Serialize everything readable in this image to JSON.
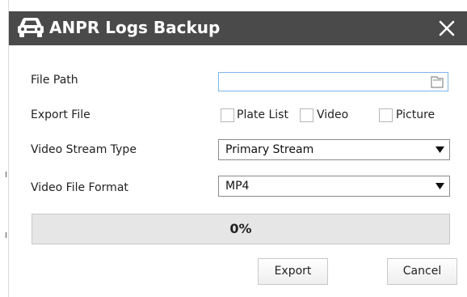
{
  "dialog": {
    "title": "ANPR Logs Backup",
    "title_icon": "car-icon",
    "close_icon": "close-icon"
  },
  "fields": {
    "file_path": {
      "label": "File Path",
      "value": "",
      "button_icon": "folder-icon"
    },
    "export_file": {
      "label": "Export File",
      "options": [
        {
          "label": "Plate List",
          "checked": false
        },
        {
          "label": "Video",
          "checked": false
        },
        {
          "label": "Picture",
          "checked": false
        }
      ]
    },
    "video_stream_type": {
      "label": "Video Stream Type",
      "value": "Primary Stream",
      "arrow_icon": "dropdown-arrow-icon"
    },
    "video_file_format": {
      "label": "Video File Format",
      "value": "MP4",
      "arrow_icon": "dropdown-arrow-icon"
    }
  },
  "progress": {
    "text": "0%",
    "fraction": 0
  },
  "buttons": {
    "export": "Export",
    "cancel": "Cancel"
  },
  "colors": {
    "titlebar": "#4a4a4a",
    "input_border": "#7fb4e8",
    "progress_bg": "#e6e6e6"
  }
}
